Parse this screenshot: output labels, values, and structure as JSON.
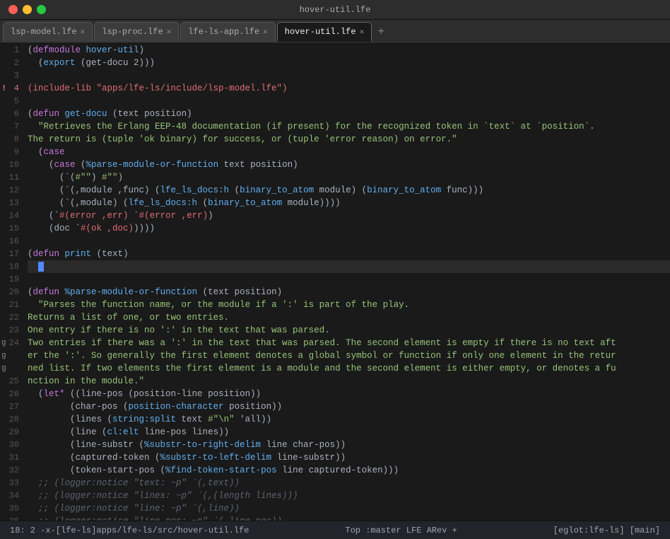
{
  "titlebar": {
    "title": "hover-util.lfe"
  },
  "tabs": [
    {
      "id": "tab1",
      "label": "lsp-model.lfe",
      "active": false,
      "closeable": true
    },
    {
      "id": "tab2",
      "label": "lsp-proc.lfe",
      "active": false,
      "closeable": true
    },
    {
      "id": "tab3",
      "label": "lfe-ls-app.lfe",
      "active": false,
      "closeable": true
    },
    {
      "id": "tab4",
      "label": "hover-util.lfe",
      "active": true,
      "closeable": true
    }
  ],
  "statusbar": {
    "left": "18: 2  -x-[lfe-ls]apps/lfe-ls/src/hover-util.lfe",
    "center": "Top  :master  LFE  ARev +",
    "right": "[eglot:lfe-ls]  [main]"
  }
}
